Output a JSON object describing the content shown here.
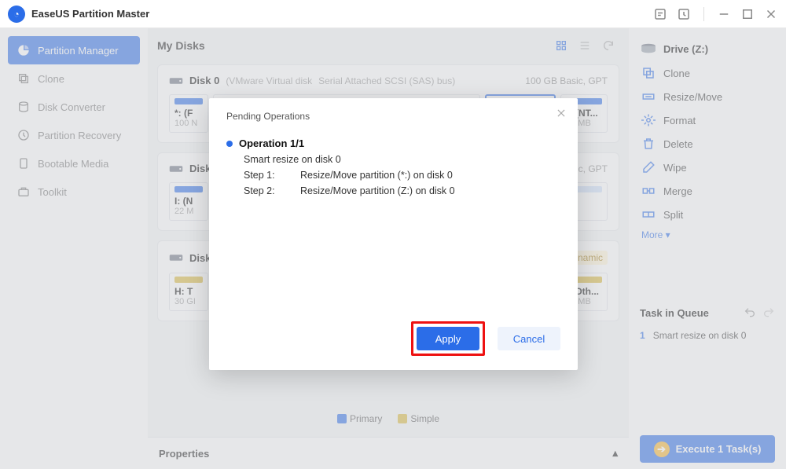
{
  "app": {
    "title": "EaseUS Partition Master"
  },
  "sidebar": {
    "items": [
      {
        "label": "Partition Manager"
      },
      {
        "label": "Clone"
      },
      {
        "label": "Disk Converter"
      },
      {
        "label": "Partition Recovery"
      },
      {
        "label": "Bootable Media"
      },
      {
        "label": "Toolkit"
      }
    ]
  },
  "center": {
    "title": "My Disks",
    "disk0": {
      "name": "Disk 0",
      "vendor": "(VMware  Virtual disk",
      "bus": "Serial Attached SCSI (SAS) bus)",
      "info": "100 GB Basic, GPT",
      "p1": {
        "name": "*: (F",
        "size": "100 N"
      },
      "p4": {
        "name": "*: (NT...",
        "size": "99 MB"
      }
    },
    "disk1": {
      "name": "Disk",
      "info": "asic, GPT",
      "p1": {
        "name": "I: (N",
        "size": "22 M"
      }
    },
    "disk2": {
      "name": "Disk",
      "info": "Dynamic",
      "p1": {
        "name": "H: T",
        "size": "30 GI"
      },
      "p2": {
        "name": ": (Oth...",
        "size": "27 MB"
      }
    },
    "legend": {
      "primary": "Primary",
      "simple": "Simple"
    },
    "properties": "Properties"
  },
  "rightpanel": {
    "drive": "Drive (Z:)",
    "actions": {
      "clone": "Clone",
      "resize": "Resize/Move",
      "format": "Format",
      "delete": "Delete",
      "wipe": "Wipe",
      "merge": "Merge",
      "split": "Split"
    },
    "more": "More  ▾",
    "taskq": "Task in Queue",
    "task_num": "1",
    "task_label": "Smart resize on disk 0",
    "exec": "Execute 1 Task(s)"
  },
  "modal": {
    "title": "Pending Operations",
    "op_head": "Operation 1/1",
    "smart": "Smart resize on disk 0",
    "step1n": "Step 1:",
    "step1v": "Resize/Move partition (*:) on disk 0",
    "step2n": "Step 2:",
    "step2v": "Resize/Move partition (Z:) on disk 0",
    "apply": "Apply",
    "cancel": "Cancel"
  }
}
